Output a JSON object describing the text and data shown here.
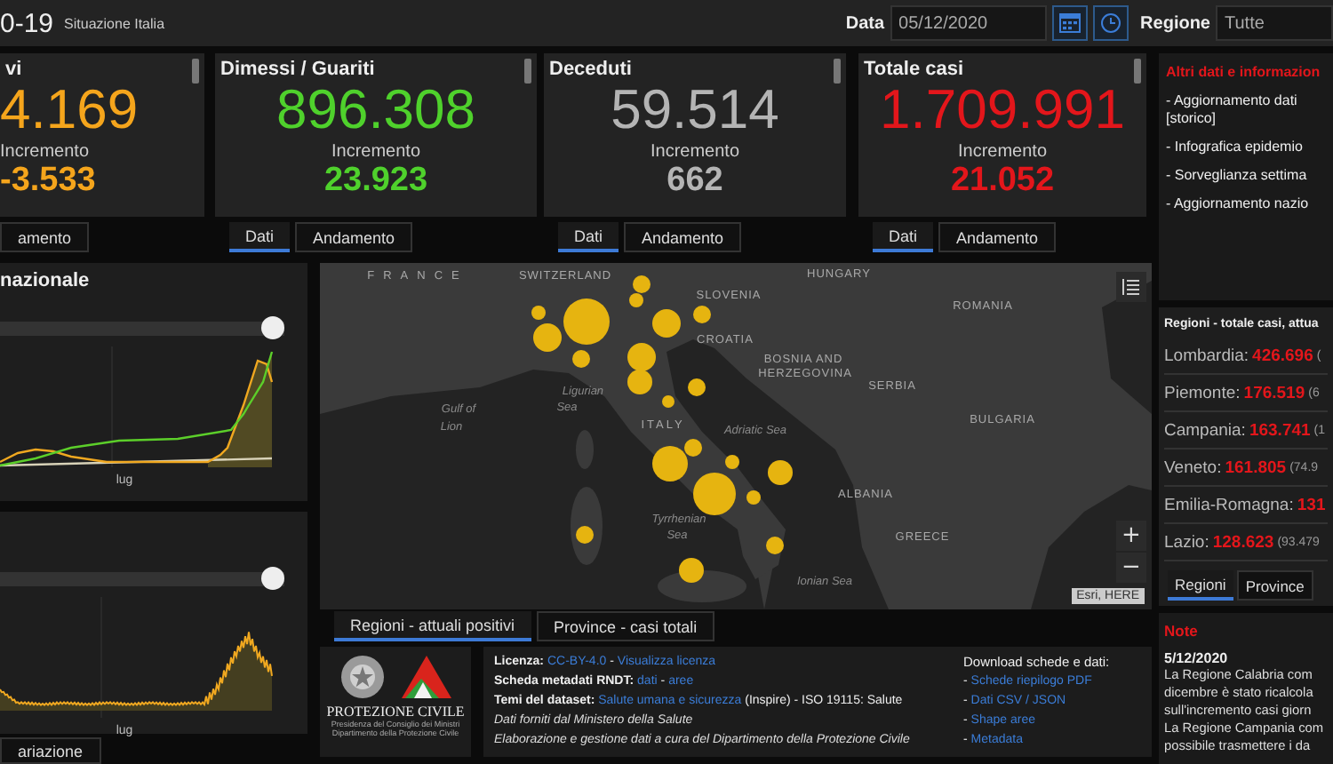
{
  "header": {
    "title": "0-19",
    "subtitle": "Situazione Italia",
    "date_label": "Data",
    "date_value": "05/12/2020",
    "region_label": "Regione",
    "region_value": "Tutte"
  },
  "cards": [
    {
      "title": "vi",
      "value": "4.169",
      "increment_label": "Incremento",
      "increment": "-3.533",
      "color": "#f5a51c",
      "tabs": [
        {
          "label": "amento",
          "selected": false
        }
      ]
    },
    {
      "title": "Dimessi / Guariti",
      "value": "896.308",
      "increment_label": "Incremento",
      "increment": "23.923",
      "color": "#4fd12c",
      "tabs": [
        {
          "label": "Dati",
          "selected": true
        },
        {
          "label": "Andamento",
          "selected": false
        }
      ]
    },
    {
      "title": "Deceduti",
      "value": "59.514",
      "increment_label": "Incremento",
      "increment": "662",
      "color": "#b4b4b4",
      "tabs": [
        {
          "label": "Dati",
          "selected": true
        },
        {
          "label": "Andamento",
          "selected": false
        }
      ]
    },
    {
      "title": "Totale casi",
      "value": "1.709.991",
      "increment_label": "Incremento",
      "increment": "21.052",
      "color": "#e3161b",
      "tabs": [
        {
          "label": "Dati",
          "selected": true
        },
        {
          "label": "Andamento",
          "selected": false
        }
      ]
    }
  ],
  "info": {
    "title": "Altri dati e informazion",
    "items": [
      "- Aggiornamento dati",
      "[storico]",
      "- Infografica epidemio",
      "- Sorveglianza settima",
      "- Aggiornamento nazio"
    ]
  },
  "charts": [
    {
      "title": "nazionale",
      "axis_label": "lug",
      "level": 1
    },
    {
      "axis_label": "lug",
      "level": 1
    }
  ],
  "chart_tabs": [
    {
      "label": "ariazione",
      "selected": false
    }
  ],
  "map": {
    "labels": [
      {
        "text": "FRANCE",
        "kind": "country"
      },
      {
        "text": "SWITZERLAND",
        "kind": "country"
      },
      {
        "text": "HUNGARY",
        "kind": "country"
      },
      {
        "text": "SLOVENIA",
        "kind": "country"
      },
      {
        "text": "ROMANIA",
        "kind": "country"
      },
      {
        "text": "CROATIA",
        "kind": "country"
      },
      {
        "text": "BOSNIA AND",
        "kind": "country"
      },
      {
        "text": "HERZEGOVINA",
        "kind": "country"
      },
      {
        "text": "SERBIA",
        "kind": "country"
      },
      {
        "text": "Ligurian",
        "kind": "sea"
      },
      {
        "text": "Sea",
        "kind": "sea"
      },
      {
        "text": "Gulf of",
        "kind": "sea"
      },
      {
        "text": "Lion",
        "kind": "sea"
      },
      {
        "text": "ITALY",
        "kind": "country"
      },
      {
        "text": "Adriatic Sea",
        "kind": "sea"
      },
      {
        "text": "BULGARIA",
        "kind": "country"
      },
      {
        "text": "ALBANIA",
        "kind": "country"
      },
      {
        "text": "Tyrrhenian",
        "kind": "sea"
      },
      {
        "text": "Sea",
        "kind": "sea"
      },
      {
        "text": "GREECE",
        "kind": "country"
      },
      {
        "text": "Ionian Sea",
        "kind": "sea"
      }
    ],
    "zoom_in": "+",
    "zoom_out": "−",
    "attribution": "Esri, HERE",
    "tabs": [
      {
        "label": "Regioni - attuali positivi",
        "selected": true
      },
      {
        "label": "Province - casi totali",
        "selected": false
      }
    ]
  },
  "footer": {
    "brand": "PROTEZIONE CIVILE",
    "brand_lines": [
      "Presidenza del Consiglio dei Ministri",
      "Dipartimento della Protezione Civile"
    ],
    "lines": [
      [
        {
          "kind": "label",
          "text": "Licenza:"
        },
        {
          "kind": "link",
          "text": "CC-BY-4.0"
        },
        {
          "kind": "plain",
          "text": "-"
        },
        {
          "kind": "link",
          "text": "Visualizza licenza"
        }
      ],
      [
        {
          "kind": "label",
          "text": "Scheda metadati RNDT:"
        },
        {
          "kind": "link",
          "text": "dati"
        },
        {
          "kind": "plain",
          "text": "-"
        },
        {
          "kind": "link",
          "text": "aree"
        }
      ],
      [
        {
          "kind": "label",
          "text": "Temi del dataset:"
        },
        {
          "kind": "link",
          "text": "Salute umana e sicurezza"
        },
        {
          "kind": "plain",
          "text": "(Inspire) - ISO 19115: Salute"
        }
      ],
      [
        {
          "kind": "italic",
          "text": "Dati forniti dal Ministero della Salute"
        }
      ],
      [
        {
          "kind": "italic",
          "text": "Elaborazione e gestione dati a cura del Dipartimento della Protezione Civile"
        }
      ]
    ],
    "download_title": "Download schede e dati:",
    "downloads": [
      [
        {
          "kind": "plain",
          "text": "-"
        },
        {
          "kind": "link",
          "text": "Schede riepilogo PDF"
        }
      ],
      [
        {
          "kind": "plain",
          "text": "-"
        },
        {
          "kind": "link",
          "text": "Dati CSV / JSON"
        }
      ],
      [
        {
          "kind": "plain",
          "text": "-"
        },
        {
          "kind": "link",
          "text": "Shape aree"
        }
      ],
      [
        {
          "kind": "plain",
          "text": "-"
        },
        {
          "kind": "link",
          "text": "Metadata"
        }
      ]
    ]
  },
  "regions": {
    "title": "Regioni - totale casi, attua",
    "rows": [
      {
        "name": "Lombardia:",
        "value": "426.696",
        "extra": "("
      },
      {
        "name": "Piemonte:",
        "value": "176.519",
        "extra": "(6"
      },
      {
        "name": "Campania:",
        "value": "163.741",
        "extra": "(1"
      },
      {
        "name": "Veneto:",
        "value": "161.805",
        "extra": "(74.9"
      },
      {
        "name": "Emilia-Romagna:",
        "value": "131"
      },
      {
        "name": "Lazio:",
        "value": "128.623",
        "extra": "(93.479"
      }
    ],
    "tabs": [
      {
        "label": "Regioni",
        "selected": true
      },
      {
        "label": "Province",
        "selected": false
      }
    ]
  },
  "note": {
    "title": "Note",
    "date": "5/12/2020",
    "lines": [
      "La Regione Calabria com",
      "dicembre è stato ricalcola",
      "sull'incremento casi giorn",
      "La Regione Campania com",
      "possibile trasmettere i da"
    ]
  }
}
